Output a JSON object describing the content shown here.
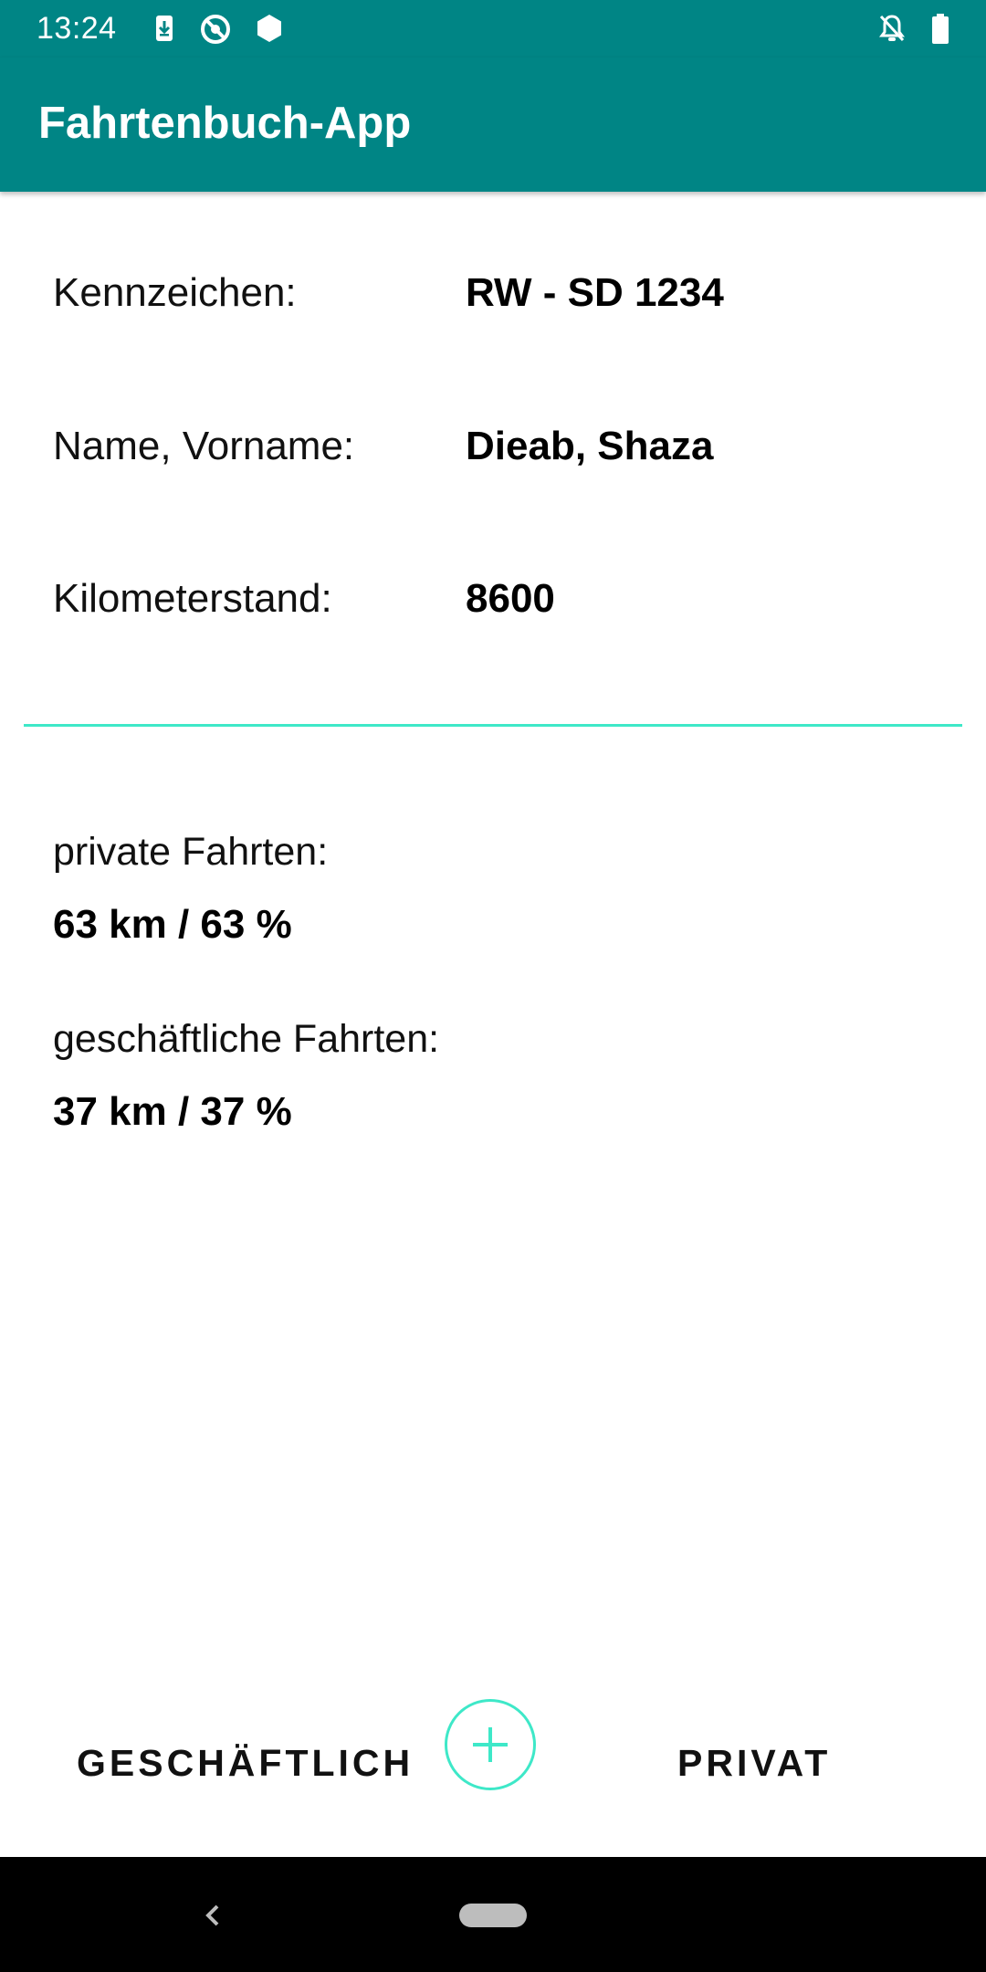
{
  "status_bar": {
    "time": "13:24"
  },
  "app_bar": {
    "title": "Fahrtenbuch-App"
  },
  "info": {
    "plate_label": "Kennzeichen:",
    "plate_value": "RW - SD 1234",
    "name_label": "Name, Vorname:",
    "name_value": "Dieab, Shaza",
    "odometer_label": "Kilometerstand:",
    "odometer_value": "8600"
  },
  "stats": {
    "private_label": "private Fahrten:",
    "private_value": "63 km / 63 %",
    "business_label": "geschäftliche Fahrten:",
    "business_value": "37 km / 37 %"
  },
  "actions": {
    "business_button": "GESCHÄFTLICH",
    "private_button": "PRIVAT",
    "add_icon": "plus-icon"
  },
  "colors": {
    "primary": "#008585",
    "accent": "#3ee8c8"
  },
  "icons": {
    "status": [
      "download-icon",
      "no-location-icon",
      "hexagon-icon",
      "notifications-off-icon",
      "battery-icon"
    ],
    "nav": [
      "back-icon",
      "home-pill"
    ]
  }
}
